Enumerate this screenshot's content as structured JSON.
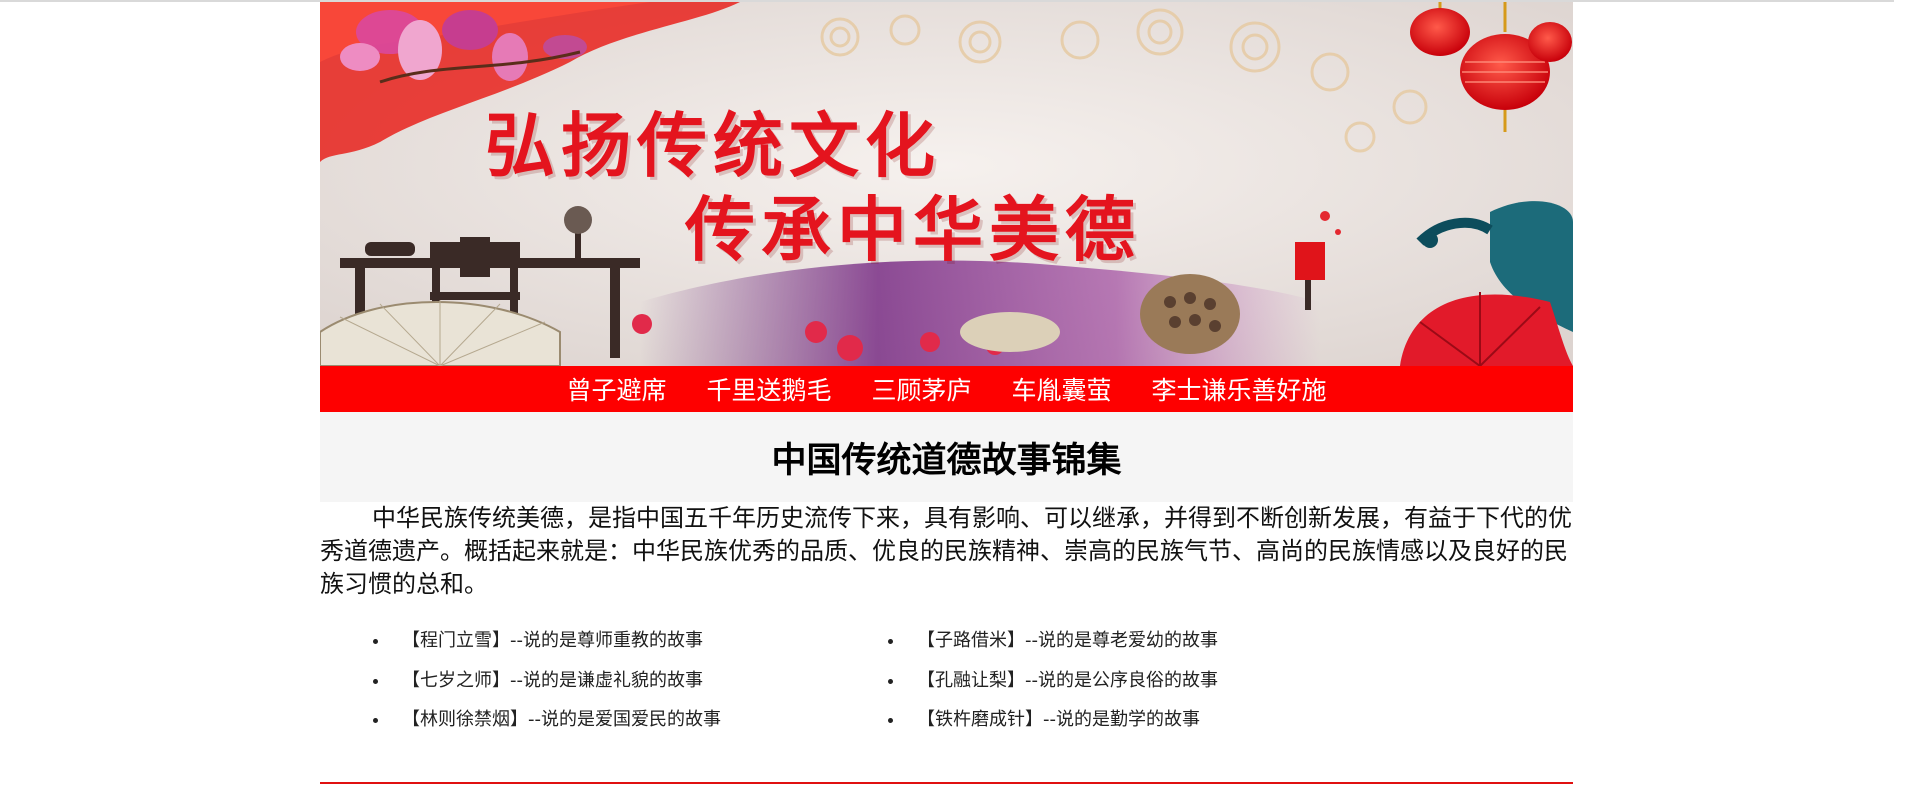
{
  "banner": {
    "line1": "弘扬传统文化",
    "line2": "传承中华美德"
  },
  "nav": {
    "items": [
      {
        "label": "曾子避席"
      },
      {
        "label": "千里送鹅毛"
      },
      {
        "label": "三顾茅庐"
      },
      {
        "label": "车胤囊萤"
      },
      {
        "label": "李士谦乐善好施"
      }
    ]
  },
  "main": {
    "title": "中国传统道德故事锦集",
    "intro": "中华民族传统美德，是指中国五千年历史流传下来，具有影响、可以继承，并得到不断创新发展，有益于下代的优秀道德遗产。概括起来就是：中华民族优秀的品质、优良的民族精神、崇高的民族气节、高尚的民族情感以及良好的民族习惯的总和。",
    "stories_left": [
      {
        "text": "【程门立雪】--说的是尊师重教的故事"
      },
      {
        "text": "【七岁之师】--说的是谦虚礼貌的故事"
      },
      {
        "text": "【林则徐禁烟】--说的是爱国爱民的故事"
      }
    ],
    "stories_right": [
      {
        "text": "【子路借米】--说的是尊老爱幼的故事"
      },
      {
        "text": "【孔融让梨】--说的是公序良俗的故事"
      },
      {
        "text": "【铁杵磨成针】--说的是勤学的故事"
      }
    ]
  },
  "colors": {
    "nav_bg": "#fe0000",
    "banner_text": "#e4141e",
    "divider": "#e01010"
  }
}
